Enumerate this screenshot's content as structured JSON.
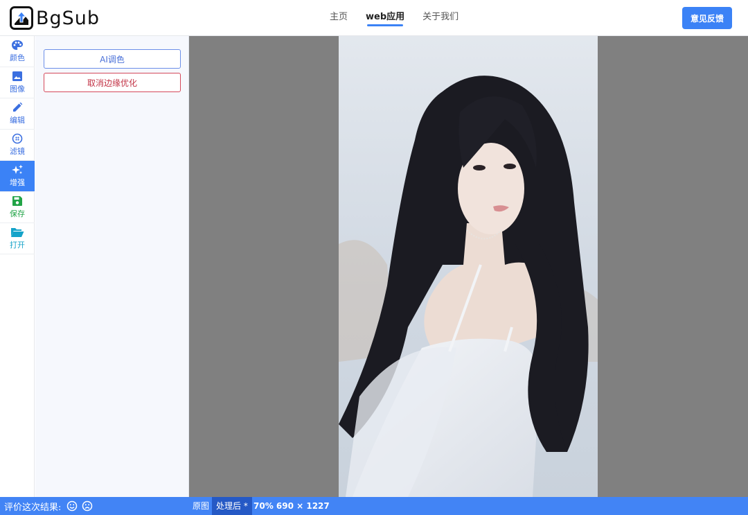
{
  "app": {
    "logo_text": "BgSub",
    "brand_color": "#3b82f6"
  },
  "nav": {
    "items": [
      {
        "label": "主页",
        "active": false
      },
      {
        "label": "web应用",
        "active": true
      },
      {
        "label": "关于我们",
        "active": false
      }
    ],
    "feedback_label": "意见反馈"
  },
  "toolbar": {
    "items": [
      {
        "label": "颜色",
        "icon": "palette-icon"
      },
      {
        "label": "图像",
        "icon": "image-icon"
      },
      {
        "label": "编辑",
        "icon": "pencil-icon"
      },
      {
        "label": "滤镜",
        "icon": "filter-icon"
      },
      {
        "label": "增强",
        "icon": "sparkles-icon",
        "active": true
      },
      {
        "label": "保存",
        "icon": "save-icon"
      },
      {
        "label": "打开",
        "icon": "folder-open-icon"
      }
    ]
  },
  "panel": {
    "ai_color_label": "AI调色",
    "cancel_edge_label": "取消边缘优化"
  },
  "statusbar": {
    "rate_label": "评价这次结果:",
    "original_label": "原图",
    "processed_label": "处理后 *",
    "zoom_info": "70% 690 × 1227"
  }
}
